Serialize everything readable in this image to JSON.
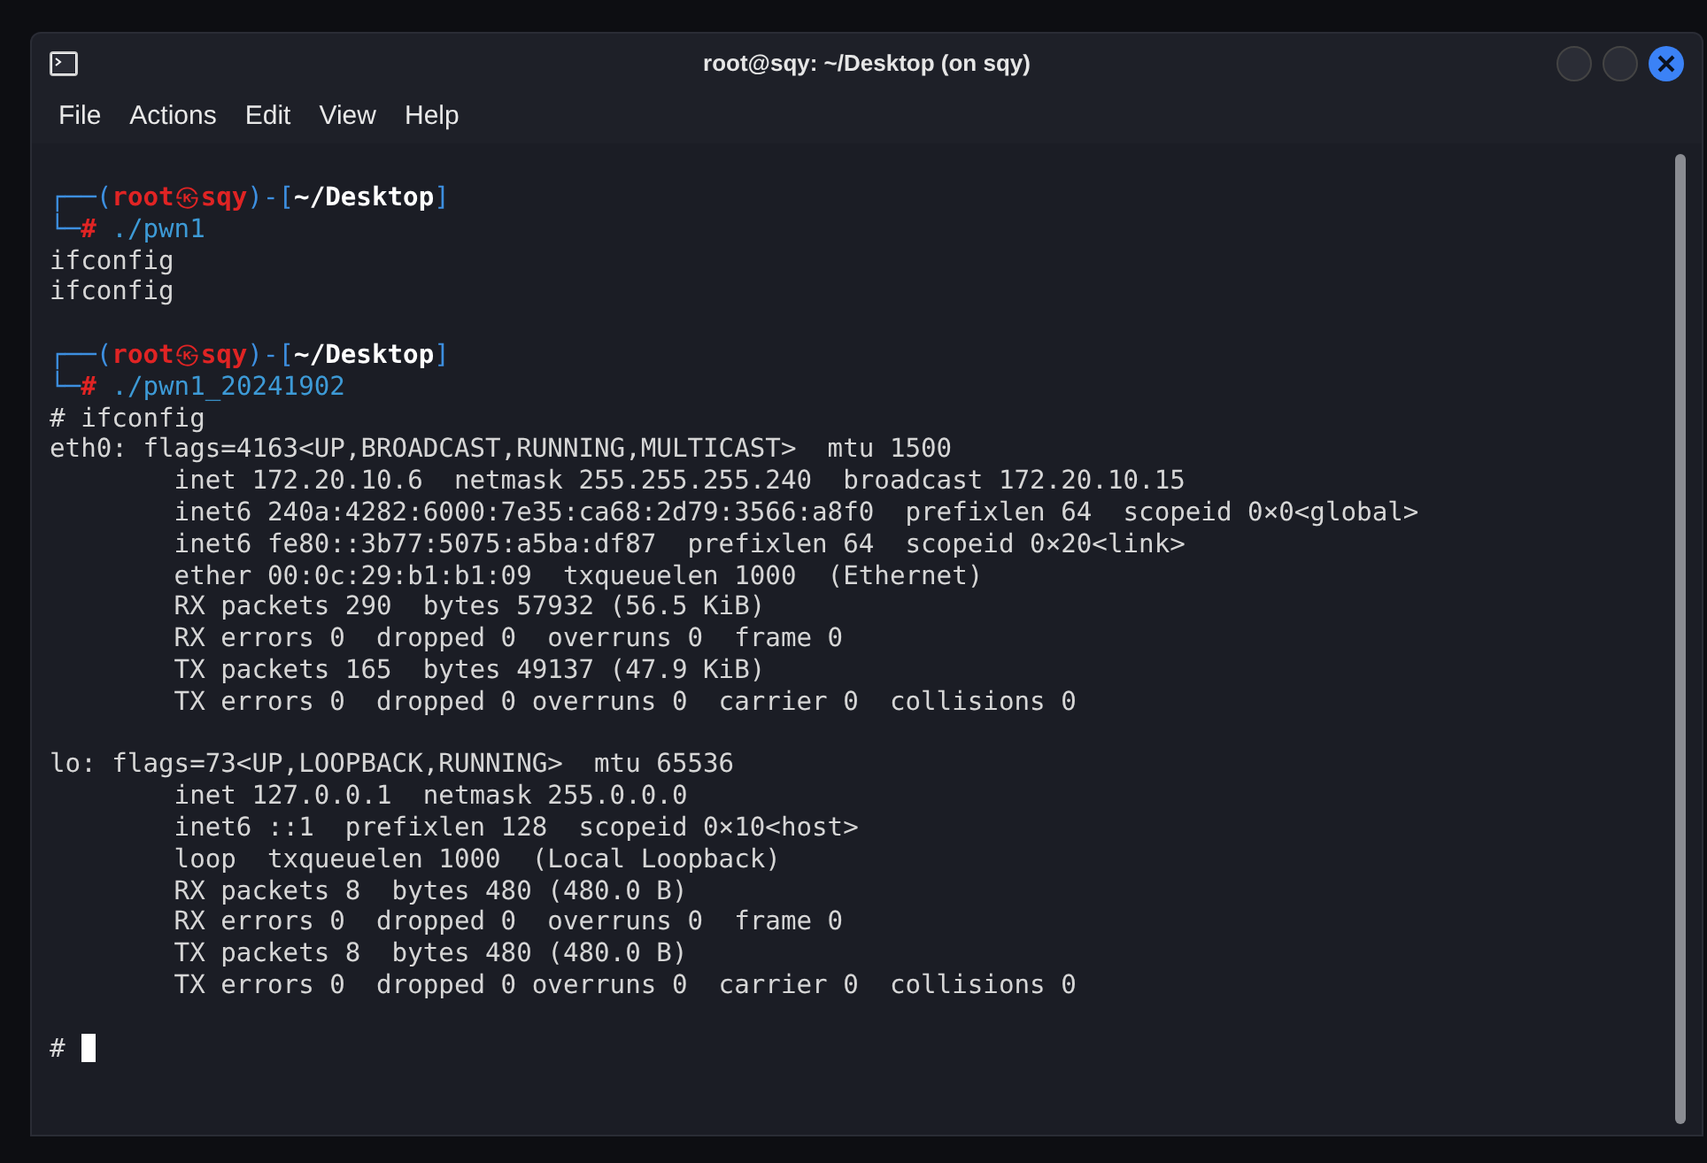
{
  "window": {
    "title": "root@sqy: ~/Desktop (on sqy)"
  },
  "menu": [
    "File",
    "Actions",
    "Edit",
    "View",
    "Help"
  ],
  "lines": [
    {
      "kind": "prompt",
      "top": "┌──(",
      "user": "root",
      "at": "㉿",
      "host": "sqy",
      "mid": ")-[",
      "dir": "~/Desktop",
      "end": "]",
      "bottom": "└─",
      "sign": "#",
      "command": "./pwn1"
    },
    {
      "kind": "output",
      "text": "ifconfig"
    },
    {
      "kind": "output",
      "text": "ifconfig"
    },
    {
      "kind": "blank"
    },
    {
      "kind": "prompt",
      "top": "┌──(",
      "user": "root",
      "at": "㉿",
      "host": "sqy",
      "mid": ")-[",
      "dir": "~/Desktop",
      "end": "]",
      "bottom": "└─",
      "sign": "#",
      "command": "./pwn1_20241902"
    },
    {
      "kind": "output",
      "text": "# ifconfig"
    },
    {
      "kind": "output",
      "text": "eth0: flags=4163<UP,BROADCAST,RUNNING,MULTICAST>  mtu 1500"
    },
    {
      "kind": "output",
      "text": "        inet 172.20.10.6  netmask 255.255.255.240  broadcast 172.20.10.15"
    },
    {
      "kind": "output",
      "text": "        inet6 240a:4282:6000:7e35:ca68:2d79:3566:a8f0  prefixlen 64  scopeid 0×0<global>"
    },
    {
      "kind": "output",
      "text": "        inet6 fe80::3b77:5075:a5ba:df87  prefixlen 64  scopeid 0×20<link>"
    },
    {
      "kind": "output",
      "text": "        ether 00:0c:29:b1:b1:09  txqueuelen 1000  (Ethernet)"
    },
    {
      "kind": "output",
      "text": "        RX packets 290  bytes 57932 (56.5 KiB)"
    },
    {
      "kind": "output",
      "text": "        RX errors 0  dropped 0  overruns 0  frame 0"
    },
    {
      "kind": "output",
      "text": "        TX packets 165  bytes 49137 (47.9 KiB)"
    },
    {
      "kind": "output",
      "text": "        TX errors 0  dropped 0 overruns 0  carrier 0  collisions 0"
    },
    {
      "kind": "blank"
    },
    {
      "kind": "output",
      "text": "lo: flags=73<UP,LOOPBACK,RUNNING>  mtu 65536"
    },
    {
      "kind": "output",
      "text": "        inet 127.0.0.1  netmask 255.0.0.0"
    },
    {
      "kind": "output",
      "text": "        inet6 ::1  prefixlen 128  scopeid 0×10<host>"
    },
    {
      "kind": "output",
      "text": "        loop  txqueuelen 1000  (Local Loopback)"
    },
    {
      "kind": "output",
      "text": "        RX packets 8  bytes 480 (480.0 B)"
    },
    {
      "kind": "output",
      "text": "        RX errors 0  dropped 0  overruns 0  frame 0"
    },
    {
      "kind": "output",
      "text": "        TX packets 8  bytes 480 (480.0 B)"
    },
    {
      "kind": "output",
      "text": "        TX errors 0  dropped 0 overruns 0  carrier 0  collisions 0"
    },
    {
      "kind": "blank"
    },
    {
      "kind": "input",
      "sign": "#"
    }
  ]
}
